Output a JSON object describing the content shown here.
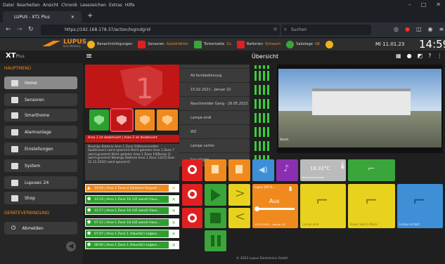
{
  "browser": {
    "menu": [
      "Datei",
      "Bearbeiten",
      "Ansicht",
      "Chronik",
      "Lesezeichen",
      "Extras",
      "Hilfe"
    ],
    "tab_title": "LUPUS - XT1 Plus",
    "url": "https://192.168.178.37/action/logindgrid",
    "search_placeholder": "Suchen"
  },
  "header": {
    "brand": "LUPUS",
    "brand_sub": "ELECTRONICS",
    "logo_xt": "XT",
    "logo_plus": "Plus",
    "notifications": "Benachrichtigungen",
    "sensors_label": "Sensoren",
    "sensors_status": "Gestörfehler",
    "sensors_count": "1",
    "contacts_label": "Türkontakte",
    "contacts_status": "Zu",
    "battery_label": "Batterien",
    "battery_status": "Schwach",
    "battery_count": "2",
    "sabotage_label": "Sabotage",
    "sabotage_status": "OK",
    "date": "Mi 11.01.23",
    "time": "14:59",
    "view_title": "Übersicht"
  },
  "sidebar": {
    "section_main": "HAUPTMENÜ",
    "items": [
      "Home",
      "Sensoren",
      "Smarthome",
      "Alarmanlage",
      "Einstellungen",
      "System",
      "Lupusec 24",
      "Shop"
    ],
    "section_device": "GERÄTEVERBINDUNG",
    "logout": "Abmelden"
  },
  "main": {
    "area_status": "Area 1 ist deaktiviert | Area 2 ist deaktiviert",
    "warn_text": "Niedrige Batterie Area 1 Zone 5(Wassermelder Spülbecken) (wird ignoriert) Nicht geladen Area 1 Zone 7 (wird ignoriert) Nicht geladen Area 1 Zone 19(Bomp 2) (wird ignoriert) Niedrige Batterie Area 1 Zone 12(CO Bad - 31.12.2020) (wird ignoriert)",
    "list": [
      "Ali fernbedienung",
      "15.02.2021 - Januar 22",
      "Rauchmelder Gang - 26.05.2022",
      "Lampe endl",
      "WZ",
      "Lampe vorhin",
      "Smartlight"
    ],
    "alarms": [
      "14:59 | Area 1 Zone 4 (Outdoor Keypad ...",
      "12:19 | Area 1 Zone 18 (UZ wand) Haus...",
      "12:17 | Area 1 Zone 18 (UZ wand) Haus...",
      "07:12 | Area 1 Zone 18 (UZ wand) Haus...",
      "07:07 | Area 1 Zone 1 (Haustür) Logbuc...",
      "06:00 | Area 1 Zone 1 (Haustür) Logbuc..."
    ],
    "temp": "18.31°C",
    "temp_label": "Temperatursensor",
    "dimmer_value": "Aus",
    "dimmer_label": "Lupus 100 % ...",
    "tile_lamp": "Lampe endl",
    "tile_power": "Power Switch Meter",
    "tile_lampe2": "Lampe schlafz",
    "tile_date": "15.02.2021 - Januar 22",
    "footer": "© 2023 Lupus Electronics GmbH",
    "cam_text": "Smart"
  }
}
